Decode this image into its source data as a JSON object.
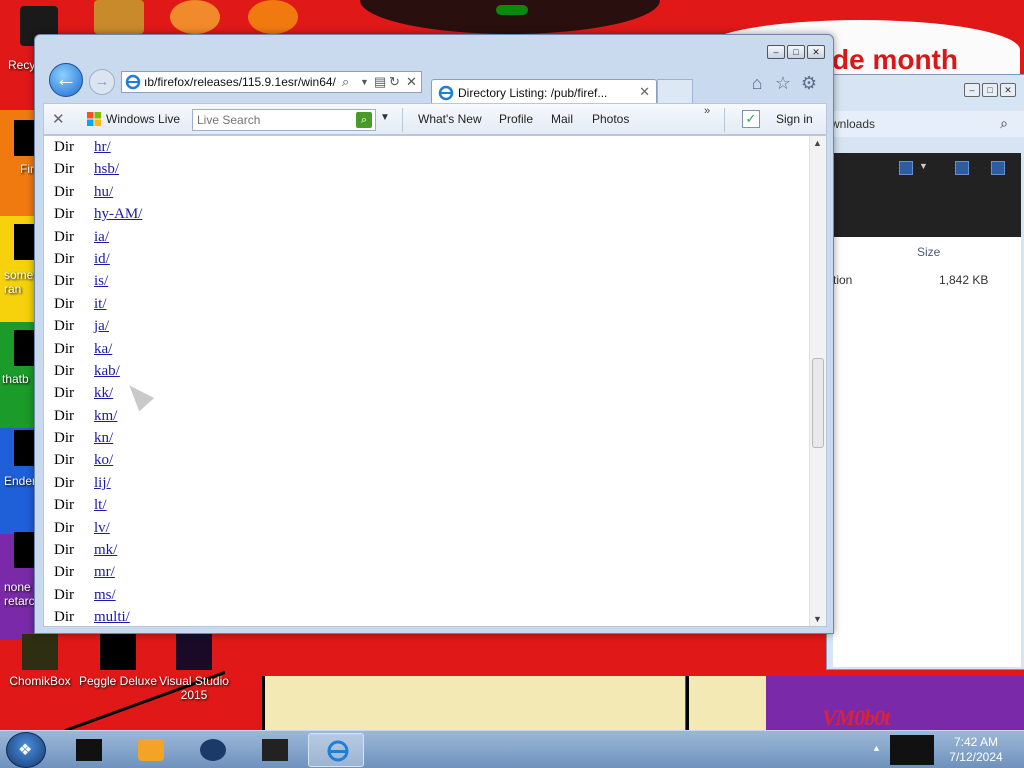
{
  "desktop": {
    "icons_bottom": [
      {
        "label": "ChomikBox"
      },
      {
        "label": "Peggle Deluxe"
      },
      {
        "label": "Visual Studio 2015"
      }
    ],
    "side_labels": [
      "Recy",
      "Fir",
      "some ran",
      "thatb",
      "Ender",
      "none retarc"
    ],
    "promo_text": "de month",
    "watermark": "VM0b0t"
  },
  "explorer_bg": {
    "path": "wnloads",
    "column_size": "Size",
    "row_name": "tion",
    "row_size": "1,842 KB"
  },
  "browser": {
    "address": "ıb/firefox/releases/115.9.1esr/win64/",
    "tab_title": "Directory Listing: /pub/firef...",
    "favorites": {
      "windows_live": "Windows Live",
      "search_placeholder": "Live Search",
      "links": [
        "What's New",
        "Profile",
        "Mail",
        "Photos"
      ],
      "sign_in": "Sign in"
    },
    "listing": [
      {
        "type": "Dir",
        "name": "hr/"
      },
      {
        "type": "Dir",
        "name": "hsb/"
      },
      {
        "type": "Dir",
        "name": "hu/"
      },
      {
        "type": "Dir",
        "name": "hy-AM/"
      },
      {
        "type": "Dir",
        "name": "ia/"
      },
      {
        "type": "Dir",
        "name": "id/"
      },
      {
        "type": "Dir",
        "name": "is/"
      },
      {
        "type": "Dir",
        "name": "it/"
      },
      {
        "type": "Dir",
        "name": "ja/"
      },
      {
        "type": "Dir",
        "name": "ka/"
      },
      {
        "type": "Dir",
        "name": "kab/"
      },
      {
        "type": "Dir",
        "name": "kk/"
      },
      {
        "type": "Dir",
        "name": "km/"
      },
      {
        "type": "Dir",
        "name": "kn/"
      },
      {
        "type": "Dir",
        "name": "ko/"
      },
      {
        "type": "Dir",
        "name": "lij/"
      },
      {
        "type": "Dir",
        "name": "lt/"
      },
      {
        "type": "Dir",
        "name": "lv/"
      },
      {
        "type": "Dir",
        "name": "mk/"
      },
      {
        "type": "Dir",
        "name": "mr/"
      },
      {
        "type": "Dir",
        "name": "ms/"
      },
      {
        "type": "Dir",
        "name": "multi/"
      }
    ]
  },
  "taskbar": {
    "time": "7:42 AM",
    "date": "7/12/2024"
  },
  "colors": {
    "wallpaper_red": "#e01818",
    "link_blue": "#1a1aa6",
    "ie_frame": "#c9d9ee"
  }
}
